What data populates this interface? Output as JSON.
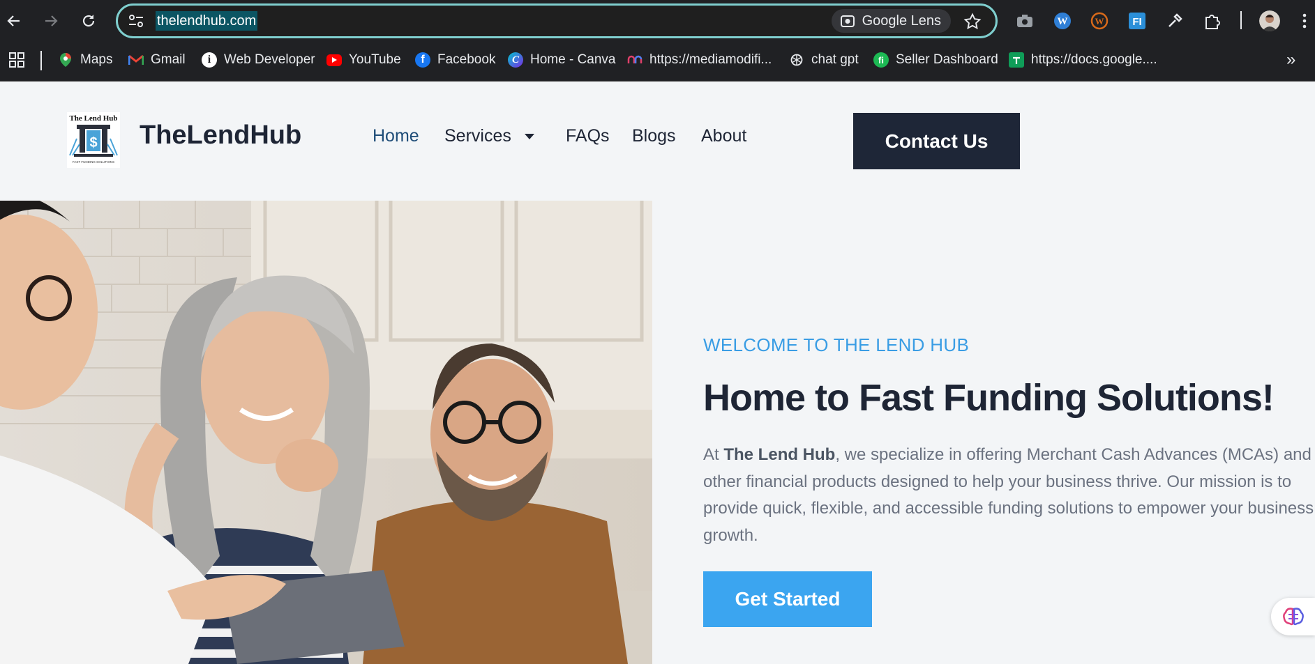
{
  "browser": {
    "url": "thelendhub.com",
    "lens_label": "Google Lens",
    "bookmarks": [
      {
        "label": "Maps",
        "icon": "maps-icon"
      },
      {
        "label": "Gmail",
        "icon": "gmail-icon"
      },
      {
        "label": "Web Developer",
        "icon": "info-icon"
      },
      {
        "label": "YouTube",
        "icon": "youtube-icon"
      },
      {
        "label": "Facebook",
        "icon": "facebook-icon"
      },
      {
        "label": "Home - Canva",
        "icon": "canva-icon"
      },
      {
        "label": "https://mediamodifi...",
        "icon": "meta-icon"
      },
      {
        "label": "chat gpt",
        "icon": "openai-icon"
      },
      {
        "label": "Seller Dashboard",
        "icon": "seller-icon"
      },
      {
        "label": "https://docs.google....",
        "icon": "sheets-icon"
      }
    ],
    "overflow_glyph": "»"
  },
  "site": {
    "logo_text": "The Lend Hub",
    "logo_caption": "FAST FUNDING SOLUTIONS",
    "brand": "TheLendHub",
    "nav": {
      "home": "Home",
      "services": "Services",
      "faqs": "FAQs",
      "blogs": "Blogs",
      "about": "About"
    },
    "contact_label": "Contact Us"
  },
  "hero": {
    "kicker": "WELCOME TO THE LEND HUB",
    "headline": "Home to Fast Funding Solutions!",
    "para_prefix": "At ",
    "para_bold": "The Lend Hub",
    "para_rest": ", we specialize in offering Merchant Cash Advances (MCAs) and other financial products designed to help your business thrive. Our mission is to provide quick, flexible, and accessible funding solutions to empower your business growth.",
    "cta_label": "Get Started"
  },
  "colors": {
    "accent": "#3ba5f0",
    "dark": "#1e2637",
    "page_bg": "#f3f5f7"
  }
}
